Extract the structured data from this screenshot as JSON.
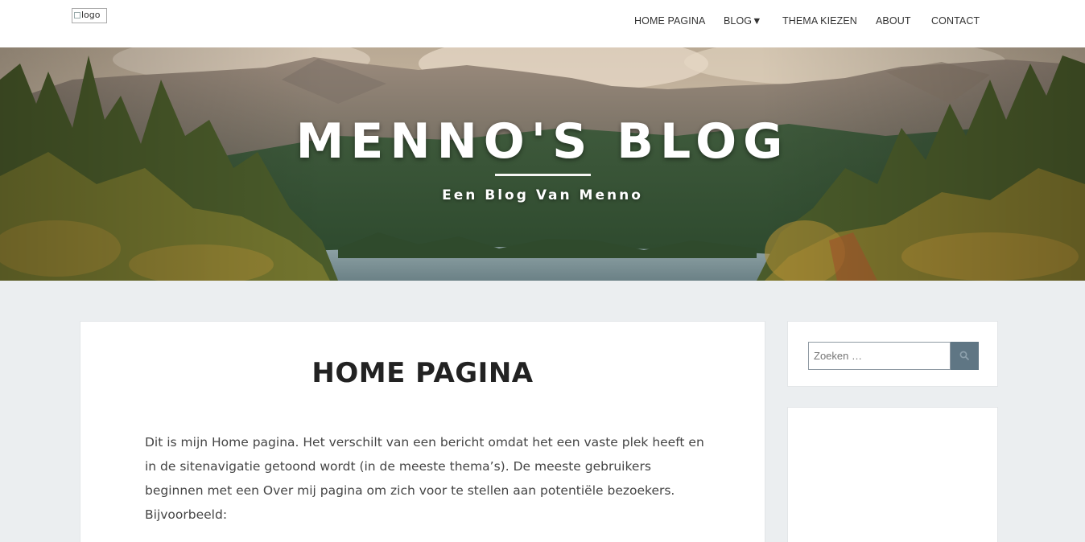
{
  "header": {
    "logo_alt": "logo",
    "nav": [
      {
        "label": "HOME PAGINA"
      },
      {
        "label": "BLOG▼"
      },
      {
        "label": "THEMA KIEZEN"
      },
      {
        "label": "ABOUT"
      },
      {
        "label": "CONTACT"
      }
    ]
  },
  "hero": {
    "title": "MENNO'S BLOG",
    "subtitle": "Een Blog Van Menno",
    "image": "mountain-lake-forest-banner"
  },
  "main": {
    "title": "HOME PAGINA",
    "body": "Dit is mijn Home pagina. Het verschilt van een bericht omdat het een vaste plek heeft en in de sitenavigatie getoond wordt (in de meeste thema’s). De meeste gebruikers beginnen met een Over mij pagina om zich voor te stellen aan potentiële bezoekers. Bijvoorbeeld:"
  },
  "sidebar": {
    "search": {
      "placeholder": "Zoeken …",
      "button_icon": "search-icon"
    }
  },
  "colors": {
    "page_bg": "#ebeef0",
    "search_button": "#5f7684",
    "text": "#444444"
  }
}
